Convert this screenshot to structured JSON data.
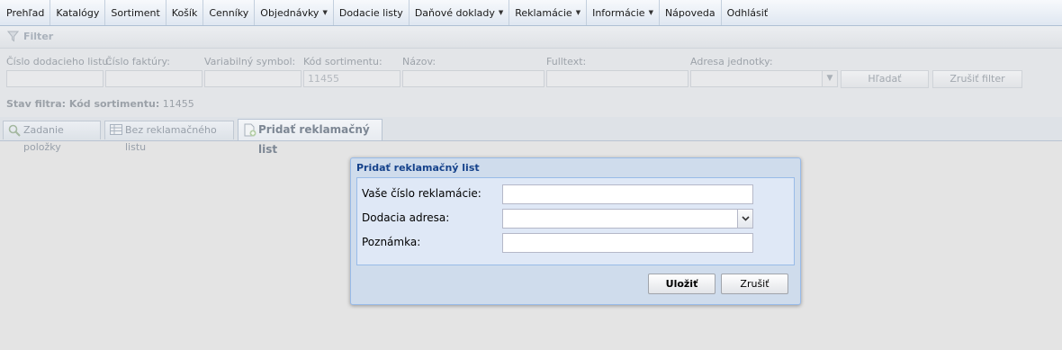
{
  "menu": {
    "items": [
      {
        "label": "Prehľad",
        "dropdown": false
      },
      {
        "label": "Katalógy",
        "dropdown": false
      },
      {
        "label": "Sortiment",
        "dropdown": false
      },
      {
        "label": "Košík",
        "dropdown": false
      },
      {
        "label": "Cenníky",
        "dropdown": false
      },
      {
        "label": "Objednávky",
        "dropdown": true
      },
      {
        "label": "Dodacie listy",
        "dropdown": false
      },
      {
        "label": "Daňové doklady",
        "dropdown": true
      },
      {
        "label": "Reklamácie",
        "dropdown": true
      },
      {
        "label": "Informácie",
        "dropdown": true
      },
      {
        "label": "Nápoveda",
        "dropdown": false
      },
      {
        "label": "Odhlásiť",
        "dropdown": false
      }
    ]
  },
  "filter": {
    "title": "Filter",
    "labels": {
      "dodaci_list": "Číslo dodacieho listu:",
      "faktura": "Číslo faktúry:",
      "var_symbol": "Variabilný symbol:",
      "kod_sortimentu": "Kód sortimentu:",
      "nazov": "Názov:",
      "fulltext": "Fulltext:",
      "adresa": "Adresa jednotky:"
    },
    "values": {
      "dodaci_list": "",
      "faktura": "",
      "var_symbol": "",
      "kod_sortimentu": "11455",
      "nazov": "",
      "fulltext": "",
      "adresa": ""
    },
    "search_button": "Hľadať",
    "clear_button": "Zrušiť filter",
    "status_prefix": "Stav filtra: Kód sortimentu:",
    "status_value": "11455"
  },
  "tabs": [
    {
      "label": "Zadanie položky",
      "icon": "magnifier-user-icon",
      "active": false
    },
    {
      "label": "Bez reklamačného listu",
      "icon": "table-icon",
      "active": false
    },
    {
      "label": "Pridať reklamačný list",
      "icon": "document-add-icon",
      "active": true
    }
  ],
  "dialog": {
    "title": "Pridať reklamačný list",
    "fields": {
      "claim_number_label": "Vaše číslo reklamácie:",
      "claim_number_value": "",
      "delivery_address_label": "Dodacia adresa:",
      "delivery_address_value": "",
      "note_label": "Poznámka:",
      "note_value": ""
    },
    "save_button": "Uložiť",
    "cancel_button": "Zrušiť"
  },
  "colors": {
    "accent_title": "#15428b",
    "window_border": "#99bbe8",
    "window_body": "#dfe8f6"
  }
}
